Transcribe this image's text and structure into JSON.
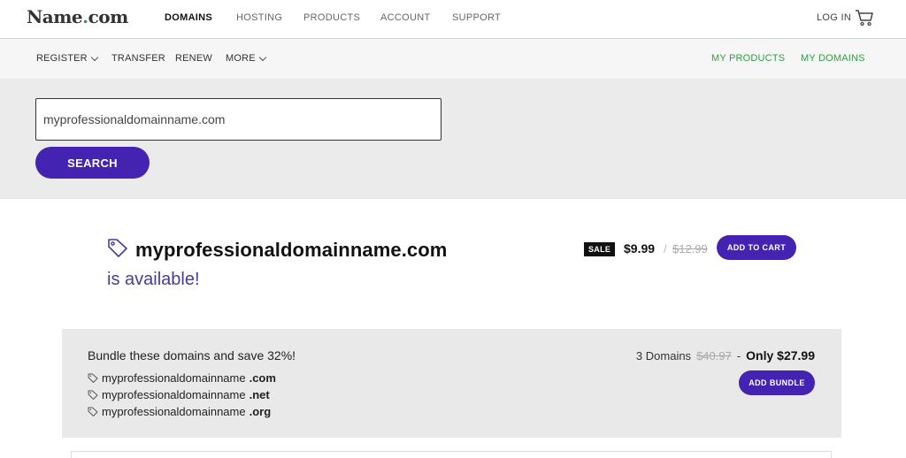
{
  "header": {
    "logo": {
      "name": "Name",
      "dot": ".",
      "tld": "com"
    },
    "nav": [
      "DOMAINS",
      "HOSTING",
      "PRODUCTS",
      "ACCOUNT",
      "SUPPORT"
    ],
    "login": "LOG IN",
    "cart_icon": "cart-icon"
  },
  "subnav": {
    "left": [
      "REGISTER",
      "TRANSFER",
      "RENEW",
      "MORE"
    ],
    "right": [
      "MY PRODUCTS",
      "MY DOMAINS"
    ]
  },
  "search": {
    "value": "myprofessionaldomainname.com",
    "button": "SEARCH"
  },
  "result": {
    "domain": "myprofessionaldomainname.com",
    "status": "is available!",
    "sale_badge": "SALE",
    "price": "$9.99",
    "separator": "/",
    "old_price": "$12.99",
    "add_to_cart": "ADD TO CART"
  },
  "bundle": {
    "title": "Bundle these domains and save 32%!",
    "domains": [
      {
        "name": "myprofessionaldomainname",
        "tld": ".com"
      },
      {
        "name": "myprofessionaldomainname",
        "tld": ".net"
      },
      {
        "name": "myprofessionaldomainname",
        "tld": ".org"
      }
    ],
    "count_label": "3 Domains",
    "old_price": "$40.97",
    "dash": "-",
    "only_price": "Only $27.99",
    "button": "ADD BUNDLE"
  },
  "colors": {
    "brand_purple": "#4423b3",
    "available_text": "#4a3a9a",
    "accent_green": "#2f9e44"
  }
}
